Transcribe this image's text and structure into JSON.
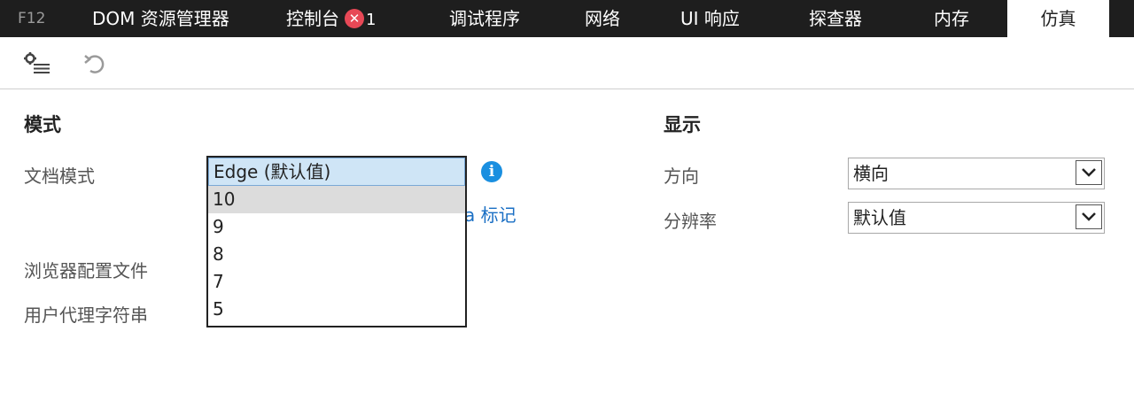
{
  "tabs": [
    {
      "id": "f12",
      "label": "F12"
    },
    {
      "id": "dom",
      "label": "DOM 资源管理器"
    },
    {
      "id": "console",
      "label": "控制台",
      "error_count": "1"
    },
    {
      "id": "debugger",
      "label": "调试程序"
    },
    {
      "id": "network",
      "label": "网络"
    },
    {
      "id": "ui",
      "label": "UI 响应"
    },
    {
      "id": "profiler",
      "label": "探查器"
    },
    {
      "id": "memory",
      "label": "内存"
    },
    {
      "id": "emulation",
      "label": "仿真"
    }
  ],
  "toolbar": {
    "settings_icon": "settings-list-icon",
    "reset_icon": "undo-icon"
  },
  "mode": {
    "title": "模式",
    "document_mode_label": "文档模式",
    "document_mode_options": [
      "Edge (默认值)",
      "10",
      "9",
      "8",
      "7",
      "5"
    ],
    "document_mode_selected": "Edge (默认值)",
    "document_mode_hovered": "10",
    "info_icon": "i",
    "partial_link": "a 标记",
    "browser_profile_label": "浏览器配置文件",
    "user_agent_label": "用户代理字符串"
  },
  "display": {
    "title": "显示",
    "orientation_label": "方向",
    "orientation_value": "横向",
    "resolution_label": "分辨率",
    "resolution_value": "默认值"
  }
}
